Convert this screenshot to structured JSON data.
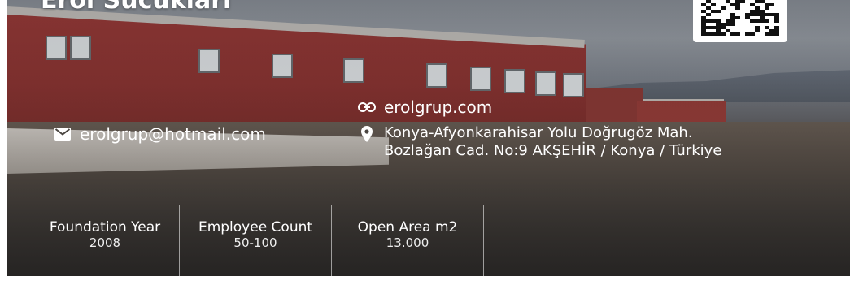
{
  "company": {
    "name": "Erol Sucukları"
  },
  "contact": {
    "email": "erolgrup@hotmail.com",
    "website": "erolgrup.com",
    "address_line1": "Konya-Afyonkarahisar Yolu Doğrugöz Mah.",
    "address_line2": "Bozlağan Cad. No:9 AKŞEHİR / Konya / Türkiye"
  },
  "stats": [
    {
      "label": "Foundation Year",
      "value": "2008"
    },
    {
      "label": "Employee Count",
      "value": "50-100"
    },
    {
      "label": "Open Area m2",
      "value": "13.000"
    }
  ],
  "icons": {
    "email": "envelope-icon",
    "website": "link-icon",
    "address": "map-pin-icon",
    "qr": "qr-code-icon"
  },
  "colors": {
    "text": "#ffffff",
    "building": "#8f3432",
    "divider": "#ffffff"
  }
}
